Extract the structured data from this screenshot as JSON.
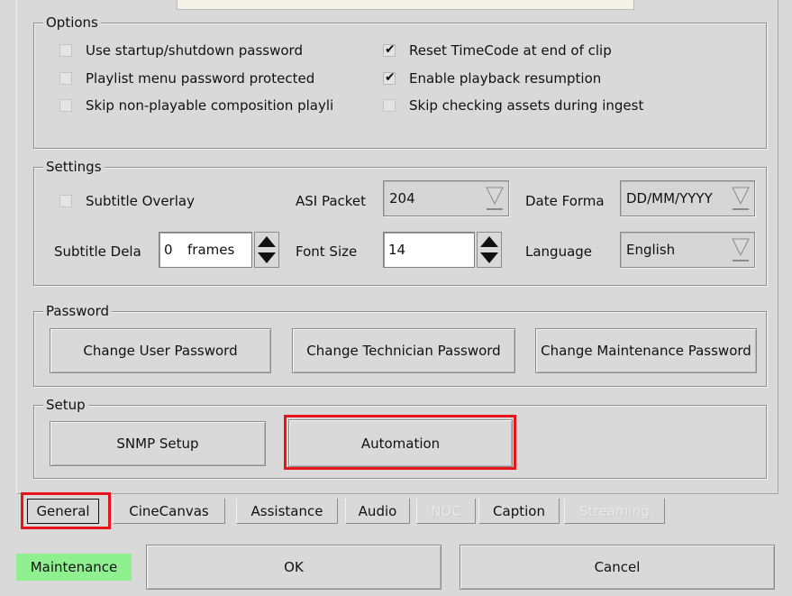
{
  "options": {
    "legend": "Options",
    "left": [
      {
        "label": "Use startup/shutdown password",
        "checked": false
      },
      {
        "label": "Playlist menu password protected",
        "checked": false
      },
      {
        "label": "Skip non-playable composition playli",
        "checked": false
      }
    ],
    "right": [
      {
        "label": "Reset TimeCode at end of clip",
        "checked": true
      },
      {
        "label": "Enable playback resumption",
        "checked": true
      },
      {
        "label": "Skip checking assets during ingest",
        "checked": false
      }
    ],
    "check_glyph": "✔"
  },
  "settings": {
    "legend": "Settings",
    "subtitle_overlay_label": "Subtitle Overlay",
    "subtitle_overlay_checked": false,
    "asi_packet_label": "ASI Packet",
    "asi_packet_value": "204",
    "date_format_label": "Date Forma",
    "date_format_value": "DD/MM/YYYY",
    "subtitle_delay_label": "Subtitle Dela",
    "subtitle_delay_value": "0",
    "subtitle_delay_unit": "frames",
    "font_size_label": "Font Size",
    "font_size_value": "14",
    "language_label": "Language",
    "language_value": "English"
  },
  "password": {
    "legend": "Password",
    "change_user": "Change User Password",
    "change_technician": "Change Technician Password",
    "change_maintenance": "Change Maintenance Password"
  },
  "setup": {
    "legend": "Setup",
    "snmp": "SNMP Setup",
    "automation": "Automation"
  },
  "tabs": [
    {
      "label": "General",
      "active": true,
      "enabled": true
    },
    {
      "label": "CineCanvas",
      "enabled": true
    },
    {
      "label": "Assistance",
      "enabled": true
    },
    {
      "label": "Audio",
      "enabled": true
    },
    {
      "label": "NOC",
      "enabled": false
    },
    {
      "label": "Caption",
      "enabled": true
    },
    {
      "label": "Streaming",
      "enabled": false
    }
  ],
  "footer": {
    "status": "Maintenance",
    "status_color": "#8ef08e",
    "ok": "OK",
    "cancel": "Cancel"
  },
  "highlight_color": "#e8141b"
}
